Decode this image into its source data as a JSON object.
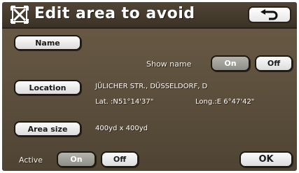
{
  "title": "Edit area to avoid",
  "icons": {
    "title": "avoid-area-icon",
    "back": "back-arrow-icon"
  },
  "name_button": "Name",
  "show_name": {
    "label": "Show name",
    "on": "On",
    "off": "Off",
    "selected": "On"
  },
  "location": {
    "button": "Location",
    "address": "JÜLICHER STR., DÜSSELDORF, D",
    "lat": "Lat. :N51°14'37\"",
    "long": "Long.:E  6°47'42\""
  },
  "area_size": {
    "button": "Area size",
    "value": "400yd x 400yd"
  },
  "active": {
    "label": "Active",
    "on": "On",
    "off": "Off",
    "selected": "On"
  },
  "ok_button": "OK",
  "colors": {
    "background": "#5e5140",
    "title_bar": "#463b2d",
    "button": "#f0f0f0",
    "selected_button": "#a5a59e"
  }
}
